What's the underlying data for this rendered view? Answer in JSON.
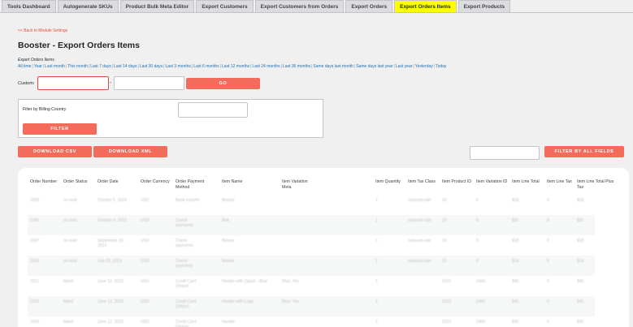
{
  "tabs": [
    "Tools Dashboard",
    "Autogenerate SKUs",
    "Product Bulk Meta Editor",
    "Export Customers",
    "Export Customers from Orders",
    "Export Orders",
    "Export Orders Items",
    "Export Products"
  ],
  "active_tab": "Export Orders Items",
  "back_link": "<< Back to Module Settings",
  "page_title": "Booster - Export Orders Items",
  "subtitle": "Export Orders Items",
  "date_ranges": [
    "All time",
    "Year",
    "Last month",
    "This month",
    "Last 7 days",
    "Last 14 days",
    "Last 30 days",
    "Last 3 months",
    "Last 6 months",
    "Last 12 months",
    "Last 24 months",
    "Last 36 months",
    "Same days last month",
    "Same days last year",
    "Last year",
    "Yesterday",
    "Today"
  ],
  "custom": {
    "label": "Custom:",
    "separator": "-",
    "go_label": "GO"
  },
  "filter_box": {
    "label": "Filter by Billing Country",
    "button": "FILTER"
  },
  "actions": {
    "download_csv": "DOWNLOAD CSV",
    "download_xml": "DOWNLOAD XML",
    "filter_all": "FILTER BY ALL FIELDS"
  },
  "table": {
    "columns": [
      "Order Number",
      "Order Status",
      "Order Date",
      "Order Currency",
      "Order Payment Method",
      "Item Name",
      "Item Variation Meta",
      "Item Quantity",
      "Item Tax Class",
      "Item Product ID",
      "Item Variation ID",
      "Item Line Total",
      "Item Line Tax",
      "Item Line Total Plus Tax"
    ],
    "rows": [
      [
        "2398",
        "on-hold",
        "October 5, 2023",
        "USD",
        "Bank transfer",
        "Beanie",
        "",
        "1",
        "reduced-rate",
        "15",
        "0",
        "$18",
        "0",
        "$18"
      ],
      [
        "2396",
        "on-hold",
        "October 4, 2023",
        "USD",
        "Check payments",
        "Belt",
        "",
        "1",
        "reduced-rate",
        "16",
        "0",
        "$55",
        "0",
        "$55"
      ],
      [
        "2387",
        "on-hold",
        "September 26, 2023",
        "USD",
        "Check payments",
        "Beanie",
        "",
        "1",
        "reduced-rate",
        "15",
        "0",
        "$18",
        "0",
        "$18"
      ],
      [
        "2354",
        "on-hold",
        "July 28, 2023",
        "USD",
        "Check payments",
        "Beanie",
        "",
        "1",
        "reduced-rate",
        "15",
        "0",
        "$18",
        "0",
        "$18"
      ],
      [
        "2311",
        "failed",
        "June 13, 2023",
        "USD",
        "Credit Card (Stripe)",
        "Hoodie with Zipper - Blue",
        "Blue, Yes",
        "1",
        "",
        "1515",
        "2466",
        "$45",
        "0",
        "$45"
      ],
      [
        "2310",
        "failed",
        "June 13, 2023",
        "USD",
        "Credit Card (Stripe)",
        "Hoodie with Logo",
        "Blue, Yes",
        "1",
        "",
        "1515",
        "2466",
        "$45",
        "0",
        "$45"
      ],
      [
        "2309",
        "failed",
        "June 13, 2023",
        "USD",
        "Credit Card (Stripe)",
        "Hoodie",
        "",
        "1",
        "",
        "1515",
        "2466",
        "$45",
        "0",
        "$45"
      ]
    ]
  }
}
